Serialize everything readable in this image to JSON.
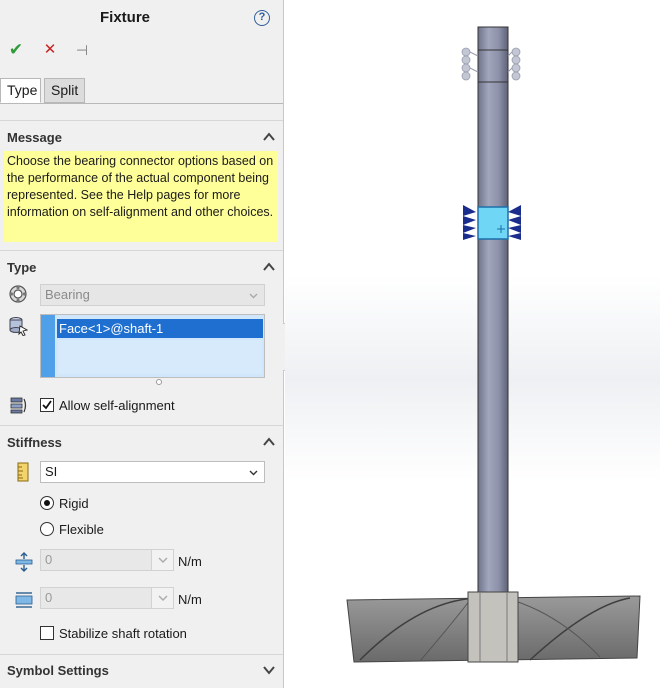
{
  "panel": {
    "title": "Fixture",
    "help_symbol": "?",
    "toolbar": {
      "ok_symbol": "✔",
      "cancel_symbol": "✕",
      "pin_symbol": "⊣"
    },
    "tabs": [
      {
        "label": "Type",
        "active": true
      },
      {
        "label": "Split",
        "active": false
      }
    ]
  },
  "message": {
    "header": "Message",
    "text": "Choose the bearing connector options based on the performance of the actual component being represented. See the Help pages for more information on self-alignment and other choices."
  },
  "type_section": {
    "header": "Type",
    "connector_type": "Bearing",
    "selection": "Face<1>@shaft-1",
    "allow_self_alignment": {
      "label": "Allow self-alignment",
      "checked": true
    }
  },
  "stiffness": {
    "header": "Stiffness",
    "unit_system": "SI",
    "rigid": {
      "label": "Rigid",
      "selected": true
    },
    "flexible": {
      "label": "Flexible",
      "selected": false
    },
    "axial": {
      "value": "0",
      "unit": "N/m"
    },
    "lateral": {
      "value": "0",
      "unit": "N/m"
    },
    "stabilize": {
      "label": "Stabilize shaft rotation",
      "checked": false
    }
  },
  "symbol_settings": {
    "header": "Symbol Settings"
  },
  "colors": {
    "accept": "#2e9b3a",
    "cancel": "#c82323",
    "message_bg": "#ffff99",
    "selection": "#1e6fd0",
    "shaft": "#8c90a8",
    "highlight": "#6fd6f6",
    "fixture_arrows": "#1a2d8c",
    "impeller": "#8a8a8a"
  },
  "icons": {
    "help": "help-icon",
    "ok": "checkmark-icon",
    "cancel": "close-icon",
    "pin": "pushpin-icon",
    "collapse": "chevron-up-icon",
    "expand": "chevron-down-icon",
    "bearing": "bearing-icon",
    "face_selection": "face-selection-icon",
    "self_alignment": "self-alignment-icon",
    "units": "ruler-icon",
    "axial_stiffness": "axial-stiffness-icon",
    "lateral_stiffness": "lateral-stiffness-icon"
  }
}
